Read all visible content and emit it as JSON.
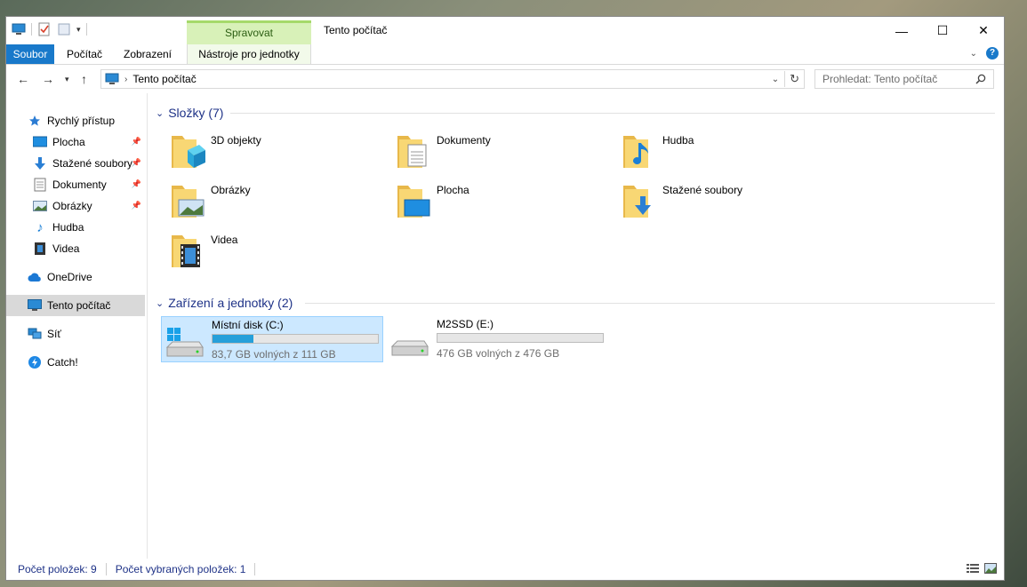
{
  "window": {
    "title": "Tento počítač",
    "context_tab": "Spravovat",
    "minimize": "—",
    "maximize": "☐",
    "close": "✕"
  },
  "ribbon": {
    "tabs": [
      "Soubor",
      "Počítač",
      "Zobrazení",
      "Nástroje pro jednotky"
    ],
    "help": "?"
  },
  "address": {
    "path": "Tento počítač",
    "search_placeholder": "Prohledat: Tento počítač"
  },
  "nav": {
    "items": [
      {
        "label": "Rychlý přístup",
        "icon": "star-icon"
      },
      {
        "label": "Plocha",
        "icon": "desktop-icon",
        "pinned": true
      },
      {
        "label": "Stažené soubory",
        "icon": "download-icon",
        "pinned": true
      },
      {
        "label": "Dokumenty",
        "icon": "document-icon",
        "pinned": true
      },
      {
        "label": "Obrázky",
        "icon": "picture-icon",
        "pinned": true
      },
      {
        "label": "Hudba",
        "icon": "music-icon"
      },
      {
        "label": "Videa",
        "icon": "video-icon"
      },
      {
        "label": "OneDrive",
        "icon": "cloud-icon"
      },
      {
        "label": "Tento počítač",
        "icon": "computer-icon",
        "selected": true
      },
      {
        "label": "Síť",
        "icon": "network-icon"
      },
      {
        "label": "Catch!",
        "icon": "catch-icon"
      }
    ]
  },
  "folders": {
    "header": "Složky (7)",
    "items": [
      {
        "label": "3D objekty",
        "icon": "3d-objects-folder-icon"
      },
      {
        "label": "Dokumenty",
        "icon": "documents-folder-icon"
      },
      {
        "label": "Hudba",
        "icon": "music-folder-icon"
      },
      {
        "label": "Obrázky",
        "icon": "pictures-folder-icon"
      },
      {
        "label": "Plocha",
        "icon": "desktop-folder-icon"
      },
      {
        "label": "Stažené soubory",
        "icon": "downloads-folder-icon"
      },
      {
        "label": "Videa",
        "icon": "videos-folder-icon"
      }
    ]
  },
  "drives": {
    "header": "Zařízení a jednotky (2)",
    "items": [
      {
        "name": "Místní disk (C:)",
        "size": "83,7 GB volných z 111 GB",
        "used_fraction": 0.246,
        "selected": true
      },
      {
        "name": "M2SSD (E:)",
        "size": "476 GB volných z 476 GB",
        "used_fraction": 0.0,
        "selected": false
      }
    ]
  },
  "status": {
    "count": "Počet položek: 9",
    "selected": "Počet vybraných položek: 1"
  },
  "colors": {
    "accent": "#1979ca",
    "header_text": "#1e3287",
    "selection": "#cce8ff",
    "drive_bar": "#26a0da",
    "context_tab": "#d8f1b8"
  }
}
